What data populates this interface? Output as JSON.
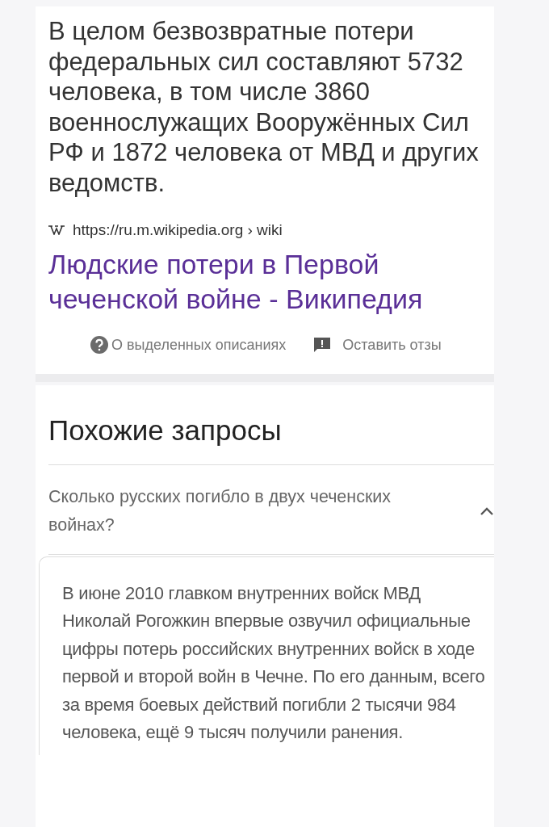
{
  "snippet": {
    "text": "В целом безвозвратные потери федеральных сил составляют 5732 человека, в том числе 3860 военнослужащих Вооружённых Сил РФ и 1872 человека от МВД и других ведомств."
  },
  "source": {
    "url": "https://ru.m.wikipedia.org › wiki",
    "title": "Людские потери в Первой чеченской войне - Википедия"
  },
  "footer_links": [
    {
      "kind": "help",
      "label": "О выделенных описаниях"
    },
    {
      "kind": "feedback",
      "label": "Оставить отзы"
    }
  ],
  "related": {
    "heading": "Похожие запросы",
    "questions": [
      {
        "question": "Сколько русских погибло в двух чеченских войнах?",
        "expanded": true,
        "answer": "В июне 2010 главком внутренних войск МВД Николай Рогожкин впервые озвучил официальные цифры потерь российских внутренних войск в ходе первой и второй войн в Чечне. По его данным, всего за время боевых действий погибли 2 тысячи 984 человека, ещё 9 тысяч получили ранения."
      }
    ]
  }
}
